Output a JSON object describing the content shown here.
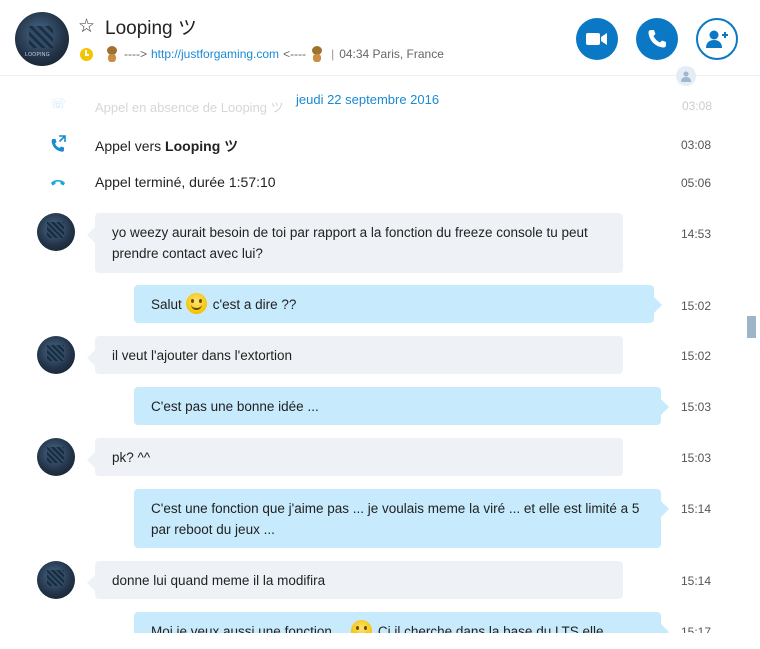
{
  "contact": {
    "name": "Looping ツ",
    "mood_arrow_left": "---->",
    "mood_link": "http://justforgaming.com",
    "mood_arrow_right": "<----",
    "local_time": "04:34 Paris, France",
    "separator": "|"
  },
  "header_buttons": {
    "video": "video-call",
    "call": "audio-call",
    "add": "add-people"
  },
  "chat": {
    "ghost_text": "Appel en absence de Looping ツ",
    "ghost_time": "03:08",
    "date_separator": "jeudi 22 septembre 2016",
    "calls": [
      {
        "prefix": "Appel vers ",
        "name": "Looping ツ",
        "time": "03:08"
      },
      {
        "prefix": "Appel terminé, durée 1:57:10",
        "name": "",
        "time": "05:06"
      }
    ],
    "messages": [
      {
        "dir": "in",
        "text": "yo weezy aurait besoin de toi par rapport a la fonction du freeze console tu peut prendre contact avec lui?",
        "time": "14:53"
      },
      {
        "dir": "out",
        "text_a": "Salut",
        "text_b": "c'est a dire ??",
        "time": "15:02"
      },
      {
        "dir": "in",
        "text": "il veut l'ajouter dans l'extortion",
        "time": "15:02"
      },
      {
        "dir": "out",
        "text": "C'est pas une bonne idée ...",
        "time": "15:03"
      },
      {
        "dir": "in",
        "text": "pk? ^^",
        "time": "15:03"
      },
      {
        "dir": "out",
        "text": "C'est une fonction que j'aime pas ... je voulais meme la viré  ...  et elle est limité a 5 par reboot du jeux ...",
        "time": "15:14"
      },
      {
        "dir": "in",
        "text": "donne lui quand meme il la modifira",
        "time": "15:14"
      },
      {
        "dir": "out",
        "text_a": "Moi je veux aussi une fonction ...",
        "text_b": "Ci il cherche dans la base du LTS elle",
        "time": "15:17"
      }
    ]
  },
  "colors": {
    "accent": "#0a78c4",
    "link": "#1a8ad4",
    "incoming_bubble": "#eef1f5",
    "outgoing_bubble": "#c7eafc",
    "status": "#f5c400"
  }
}
